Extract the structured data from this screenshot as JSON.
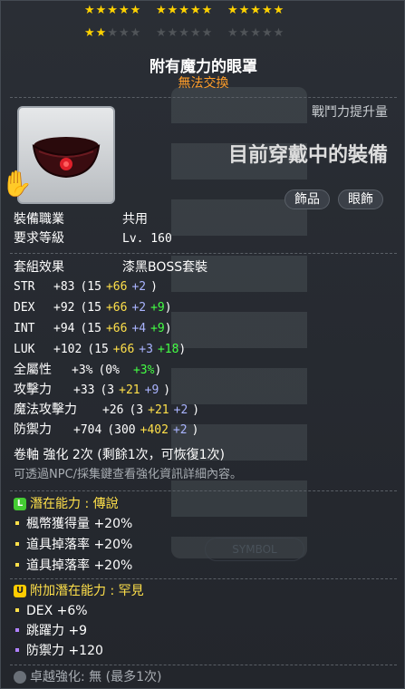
{
  "stars": {
    "row1": [
      "★★★★★",
      "★★★★★",
      "★★★★★"
    ],
    "row2_gold": "★★",
    "row2_grey": [
      "★★★",
      "★★★★★",
      "★★★★★"
    ]
  },
  "item": {
    "name": "附有魔力的眼罩",
    "trade": "無法交換",
    "power_label": "戰鬥力提升量",
    "wearing": "目前穿戴中的裝備",
    "tags": [
      "飾品",
      "眼飾"
    ]
  },
  "req": {
    "job_label": "裝備職業",
    "job_value": "共用",
    "level_label": "要求等級",
    "level_value": "Lv. 160"
  },
  "set": {
    "label": "套組效果",
    "value": "漆黑BOSS套裝"
  },
  "stats": [
    {
      "name": "STR",
      "total": "+83",
      "open": "(15",
      "a": "+66",
      "b": "+2",
      "c": "",
      "close": ")"
    },
    {
      "name": "DEX",
      "total": "+92",
      "open": "(15",
      "a": "+66",
      "b": "+2",
      "c": "+9",
      "close": ")"
    },
    {
      "name": "INT",
      "total": "+94",
      "open": "(15",
      "a": "+66",
      "b": "+4",
      "c": "+9",
      "close": ")"
    },
    {
      "name": "LUK",
      "total": "+102",
      "open": "(15",
      "a": "+66",
      "b": "+3",
      "c": "+18",
      "close": ")"
    },
    {
      "name": "全屬性",
      "total": "+3%",
      "open": "(0%",
      "a": "",
      "b": "",
      "c": "+3%",
      "close": ")"
    },
    {
      "name": "攻擊力",
      "total": "+33",
      "open": "(3",
      "a": "+21",
      "b": "+9",
      "c": "",
      "close": ")"
    },
    {
      "name": "魔法攻擊力",
      "total": "+26",
      "open": "(3",
      "a": "+21",
      "b": "+2",
      "c": "",
      "close": ")"
    },
    {
      "name": "防禦力",
      "total": "+704",
      "open": "(300",
      "a": "+402",
      "b": "+2",
      "c": "",
      "close": ")"
    }
  ],
  "scroll": {
    "line1": "卷軸 強化 2次 (剩餘1次，可恢復1次)",
    "line2": "可透過NPC/採集鍵查看強化資訊詳細內容。"
  },
  "potential": {
    "badge": "L",
    "header": "潛在能力 : 傳說",
    "lines": [
      "楓幣獲得量 +20%",
      "道具掉落率 +20%",
      "道具掉落率 +20%"
    ]
  },
  "bonus_potential": {
    "badge": "U",
    "header": "附加潛在能力 : 罕見",
    "lines": [
      "DEX +6%",
      "跳躍力 +9",
      "防禦力 +120"
    ]
  },
  "exceptional": "卓越強化:  無 (最多1次)",
  "symbol_text": "SYMBOL",
  "colors": {
    "gold_star": "#ffd200",
    "legend": "#44cc33",
    "unique": "#ffcc00",
    "accent": "#ff9e2a"
  }
}
